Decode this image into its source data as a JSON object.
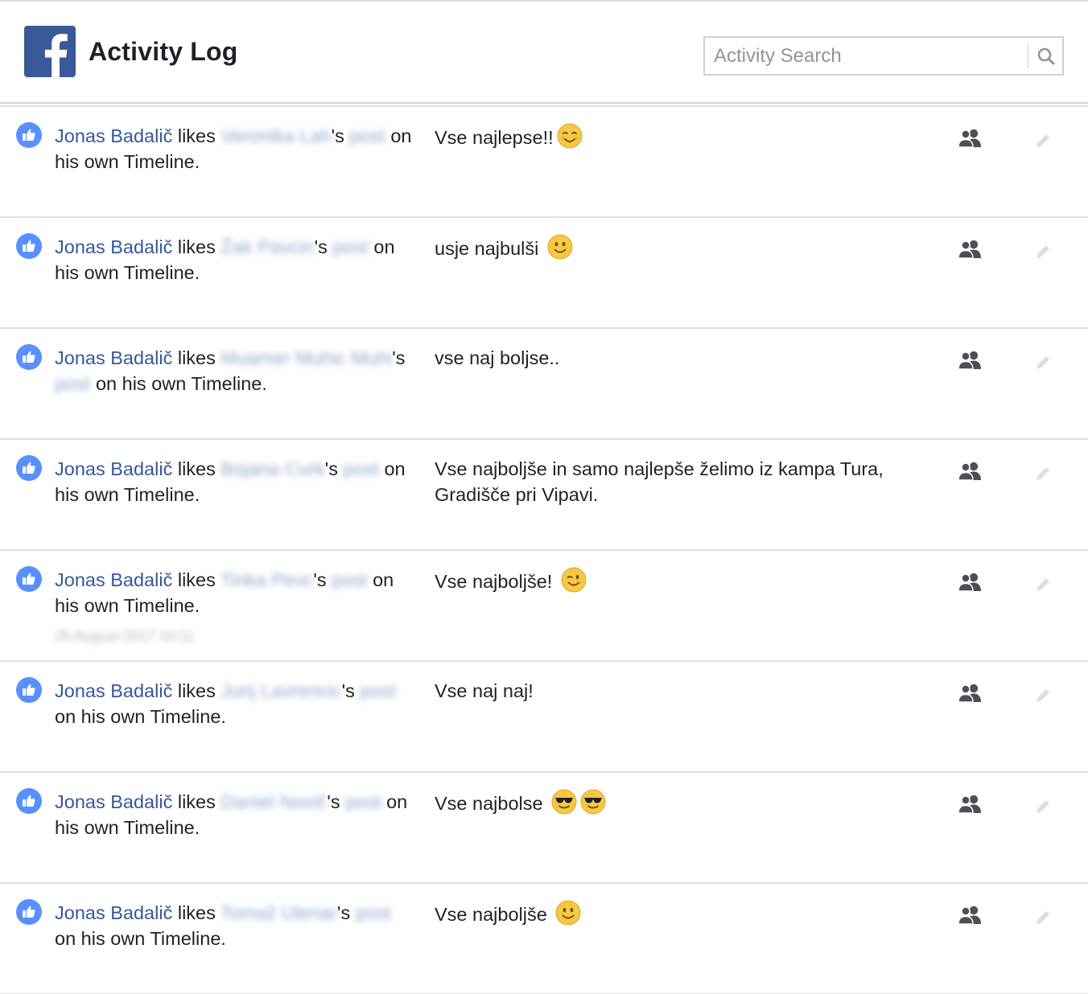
{
  "header": {
    "title": "Activity Log",
    "search_placeholder": "Activity Search",
    "logo_icon": "facebook-logo-icon",
    "brand_color": "#3b5998"
  },
  "rows": [
    {
      "actor": "Jonas Badalič",
      "verb": " likes ",
      "friend_redacted": "Veronika Lah",
      "possessive": "'s",
      "post_word": "post",
      "rest": "on his own Timeline.",
      "comment": "Vse najlepse!!",
      "emoji": "smiling-blush"
    },
    {
      "actor": "Jonas Badalič",
      "verb": " likes ",
      "friend_redacted": "Žak Pavcin",
      "possessive": "'s",
      "post_word": "post",
      "rest": "on his own Timeline.",
      "comment": "usje najbulši",
      "emoji": "slight-smile"
    },
    {
      "actor": "Jonas Badalič",
      "verb": " likes ",
      "friend_redacted": "Muamer Muhic Muhi",
      "possessive": "'s",
      "post_word": "post",
      "rest": "on his own Timeline.",
      "comment": "vse naj boljse..",
      "emoji": ""
    },
    {
      "actor": "Jonas Badalič",
      "verb": " likes ",
      "friend_redacted": "Bojana Curk",
      "possessive": "'s",
      "post_word": "post",
      "rest": "on his own Timeline.",
      "comment": "Vse najboljše in samo najlepše želimo iz kampa Tura, Gradišče pri Vipavi.",
      "emoji": ""
    },
    {
      "actor": "Jonas Badalič",
      "verb": " likes ",
      "friend_redacted": "Tinka Pevc",
      "possessive": "'s",
      "post_word": "post",
      "rest": "on his own Timeline.",
      "date_redacted": "26 August 2017 10:11",
      "comment": "Vse najboljše!",
      "emoji": "wink"
    },
    {
      "actor": "Jonas Badalič",
      "verb": " likes ",
      "friend_redacted": "Jurij Lavrencic",
      "possessive": "'s",
      "post_word": "post",
      "rest": "on his own Timeline.",
      "comment": "Vse naj naj!",
      "emoji": ""
    },
    {
      "actor": "Jonas Badalič",
      "verb": " likes ",
      "friend_redacted": "Daniel Novič",
      "possessive": "'s",
      "post_word": "post",
      "rest": "on his own Timeline.",
      "comment": "Vse najbolse",
      "emoji": "sunglasses-x2"
    },
    {
      "actor": "Jonas Badalič",
      "verb": " likes ",
      "friend_redacted": "Tomaž Ulenar",
      "possessive": "'s",
      "post_word": "post",
      "rest": "on his own Timeline.",
      "comment": "Vse najboljše",
      "emoji": "slight-smile"
    }
  ],
  "row_icons": {
    "like": "like-thumb-icon",
    "audience": "friends-audience-icon",
    "edit": "pencil-edit-icon",
    "like_color": "#5890ff",
    "link_color": "#365899"
  }
}
